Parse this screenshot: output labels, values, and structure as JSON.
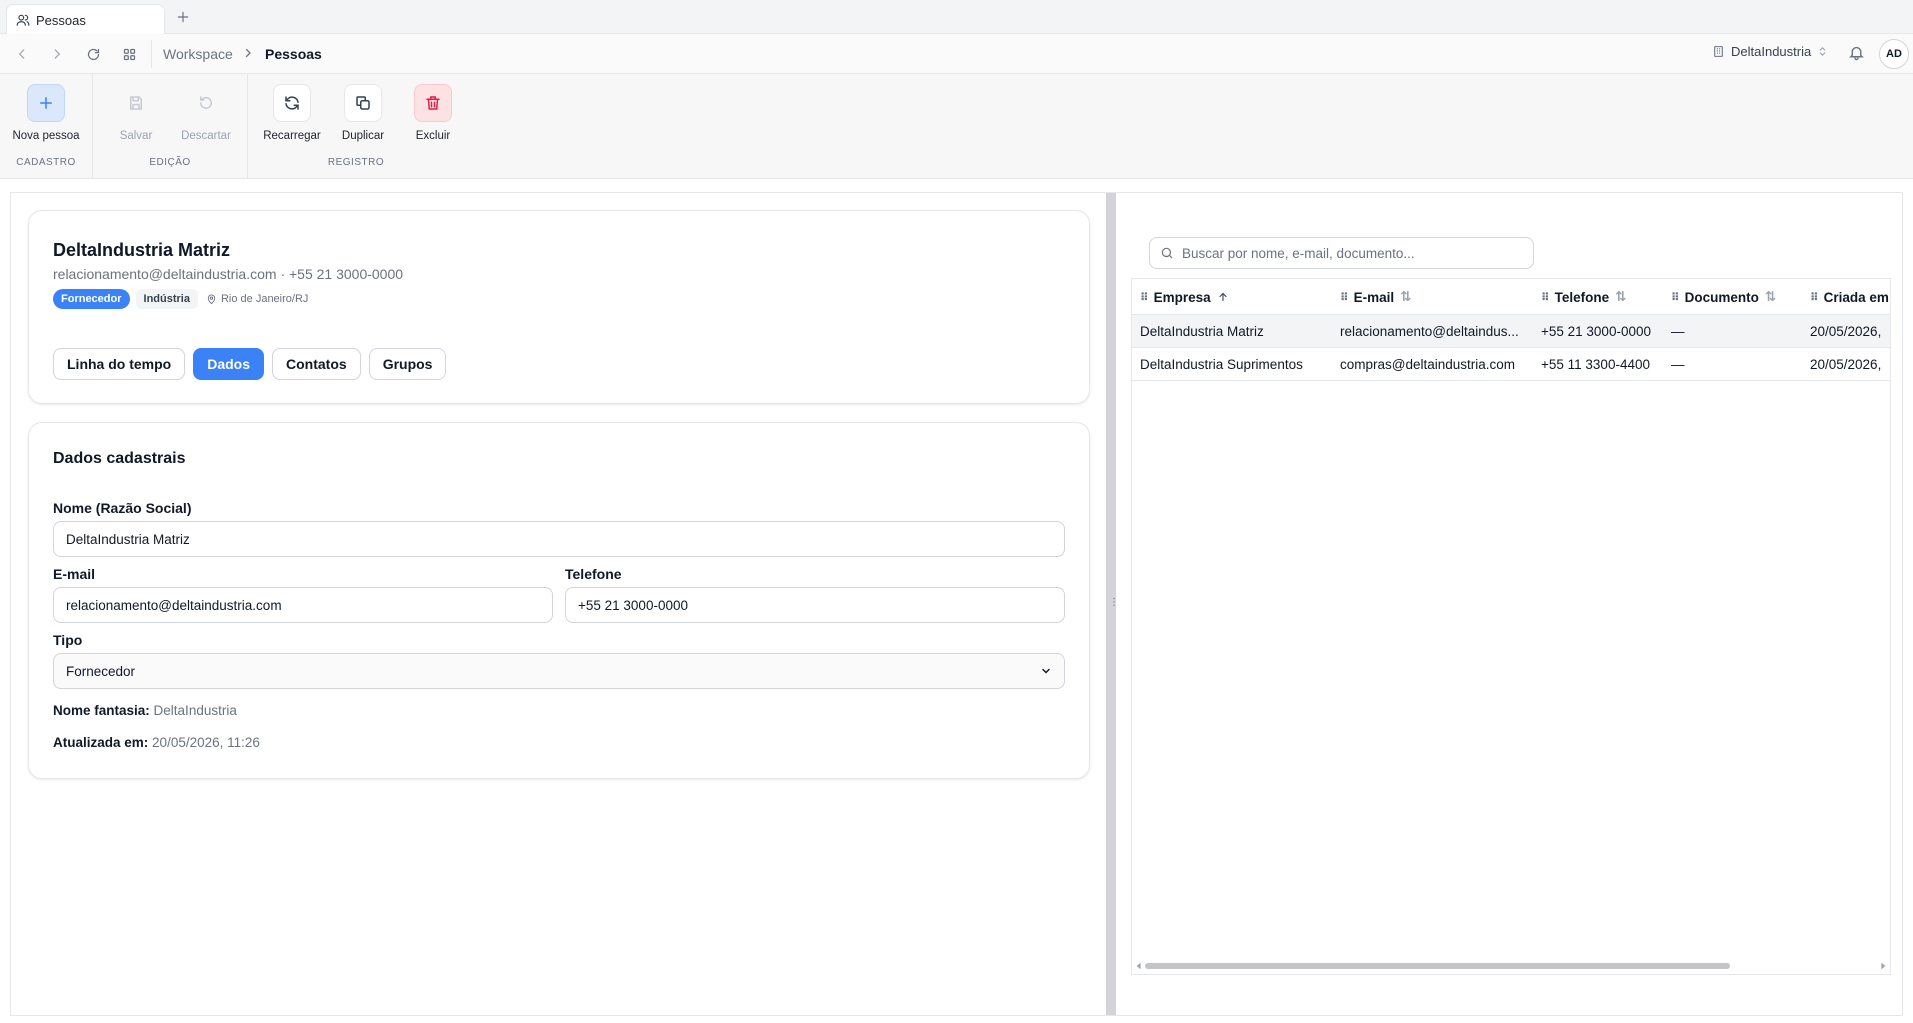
{
  "tab": {
    "title": "Pessoas",
    "icon": "users-icon"
  },
  "breadcrumb": {
    "workspace": "Workspace",
    "current": "Pessoas"
  },
  "org": {
    "name": "DeltaIndustria"
  },
  "user": {
    "initials": "AD"
  },
  "ribbon": {
    "groups": [
      {
        "label": "CADASTRO",
        "buttons": [
          {
            "label": "Nova pessoa",
            "icon": "plus-icon",
            "state": "primary"
          }
        ]
      },
      {
        "label": "EDIÇÃO",
        "buttons": [
          {
            "label": "Salvar",
            "icon": "save-icon",
            "state": "disabled"
          },
          {
            "label": "Descartar",
            "icon": "undo-icon",
            "state": "disabled"
          }
        ]
      },
      {
        "label": "REGISTRO",
        "buttons": [
          {
            "label": "Recarregar",
            "icon": "refresh-icon"
          },
          {
            "label": "Duplicar",
            "icon": "copy-icon"
          },
          {
            "label": "Excluir",
            "icon": "trash-icon",
            "state": "danger"
          }
        ]
      }
    ]
  },
  "record": {
    "title": "DeltaIndustria Matriz",
    "subtitle": "relacionamento@deltaindustria.com · +55 21 3000-0000",
    "badge_type": "Fornecedor",
    "badge_segment": "Indústria",
    "location": "Rio de Janeiro/RJ",
    "tabs": [
      "Linha do tempo",
      "Dados",
      "Contatos",
      "Grupos"
    ],
    "active_tab": "Dados"
  },
  "form": {
    "section_title": "Dados cadastrais",
    "nome_label": "Nome (Razão Social)",
    "nome_value": "DeltaIndustria Matriz",
    "email_label": "E-mail",
    "email_value": "relacionamento@deltaindustria.com",
    "telefone_label": "Telefone",
    "telefone_value": "+55 21 3000-0000",
    "tipo_label": "Tipo",
    "tipo_value": "Fornecedor",
    "fantasia_label": "Nome fantasia:",
    "fantasia_value": "DeltaIndustria",
    "atualizada_label": "Atualizada em:",
    "atualizada_value": "20/05/2026, 11:26"
  },
  "list": {
    "search_placeholder": "Buscar por nome, e-mail, documento...",
    "columns": [
      "Empresa",
      "E-mail",
      "Telefone",
      "Documento",
      "Criada em"
    ],
    "rows": [
      {
        "empresa": "DeltaIndustria Matriz",
        "email": "relacionamento@deltaindus...",
        "telefone": "+55 21 3000-0000",
        "documento": "—",
        "criada": "20/05/2026,"
      },
      {
        "empresa": "DeltaIndustria Suprimentos",
        "email": "compras@deltaindustria.com",
        "telefone": "+55 11 3300-4400",
        "documento": "—",
        "criada": "20/05/2026,"
      }
    ]
  },
  "colors": {
    "accent": "#3b82f6",
    "danger": "#e11d48"
  }
}
